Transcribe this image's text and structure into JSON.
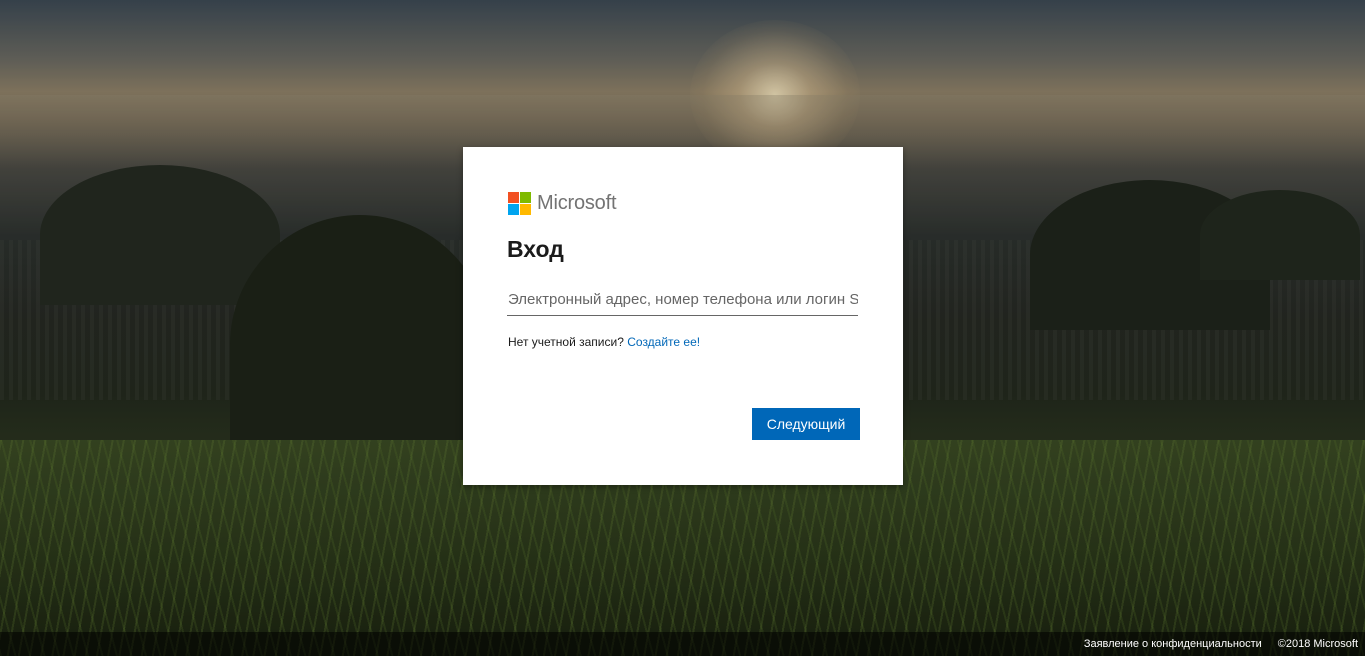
{
  "logo": {
    "text": "Microsoft",
    "colors": {
      "red": "#f25022",
      "green": "#7fba00",
      "blue": "#00a4ef",
      "yellow": "#ffb900"
    }
  },
  "signin": {
    "title": "Вход",
    "email_placeholder": "Электронный адрес, номер телефона или логин Skype",
    "email_value": "",
    "no_account_text": "Нет учетной записи?",
    "create_link": "Создайте ее!",
    "next_label": "Следующий"
  },
  "footer": {
    "privacy_link": "Заявление о конфиденциальности",
    "copyright": "©2018 Microsoft"
  },
  "colors": {
    "accent": "#0067b8",
    "text": "#1b1b1b",
    "placeholder": "#666666"
  }
}
